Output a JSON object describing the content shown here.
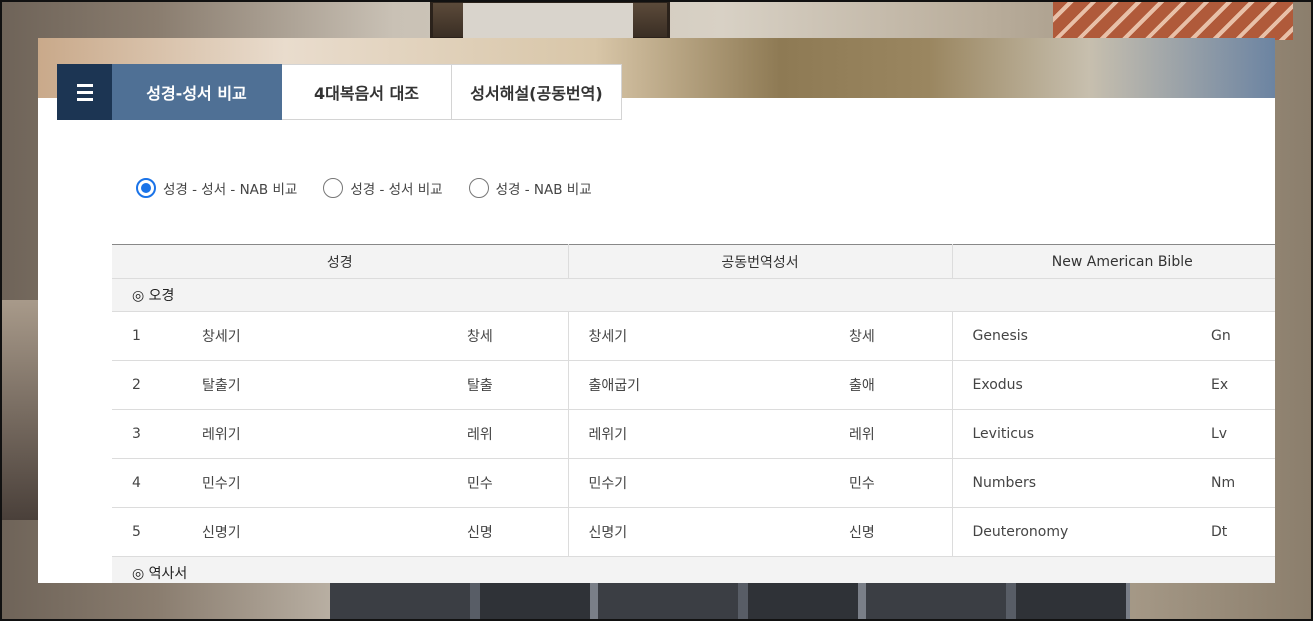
{
  "tabs": [
    {
      "label": "성경-성서 비교",
      "active": true
    },
    {
      "label": "4대복음서 대조",
      "active": false
    },
    {
      "label": "성서해설(공동번역)",
      "active": false
    }
  ],
  "radios": [
    {
      "label": "성경 - 성서 - NAB 비교",
      "checked": true
    },
    {
      "label": "성경 - 성서 비교",
      "checked": false
    },
    {
      "label": "성경 - NAB 비교",
      "checked": false
    }
  ],
  "table": {
    "headers": [
      "성경",
      "공동번역성서",
      "New American Bible"
    ],
    "sections": [
      {
        "title": "◎ 오경",
        "rows": [
          [
            "1",
            "창세기",
            "창세",
            "창세기",
            "창세",
            "Genesis",
            "Gn"
          ],
          [
            "2",
            "탈출기",
            "탈출",
            "출애굽기",
            "출애",
            "Exodus",
            "Ex"
          ],
          [
            "3",
            "레위기",
            "레위",
            "레위기",
            "레위",
            "Leviticus",
            "Lv"
          ],
          [
            "4",
            "민수기",
            "민수",
            "민수기",
            "민수",
            "Numbers",
            "Nm"
          ],
          [
            "5",
            "신명기",
            "신명",
            "신명기",
            "신명",
            "Deuteronomy",
            "Dt"
          ]
        ]
      },
      {
        "title": "◎ 역사서",
        "rows": []
      }
    ]
  },
  "colors": {
    "accent": "#4f7095",
    "menu": "#1c3553",
    "radio": "#1a73e8"
  }
}
